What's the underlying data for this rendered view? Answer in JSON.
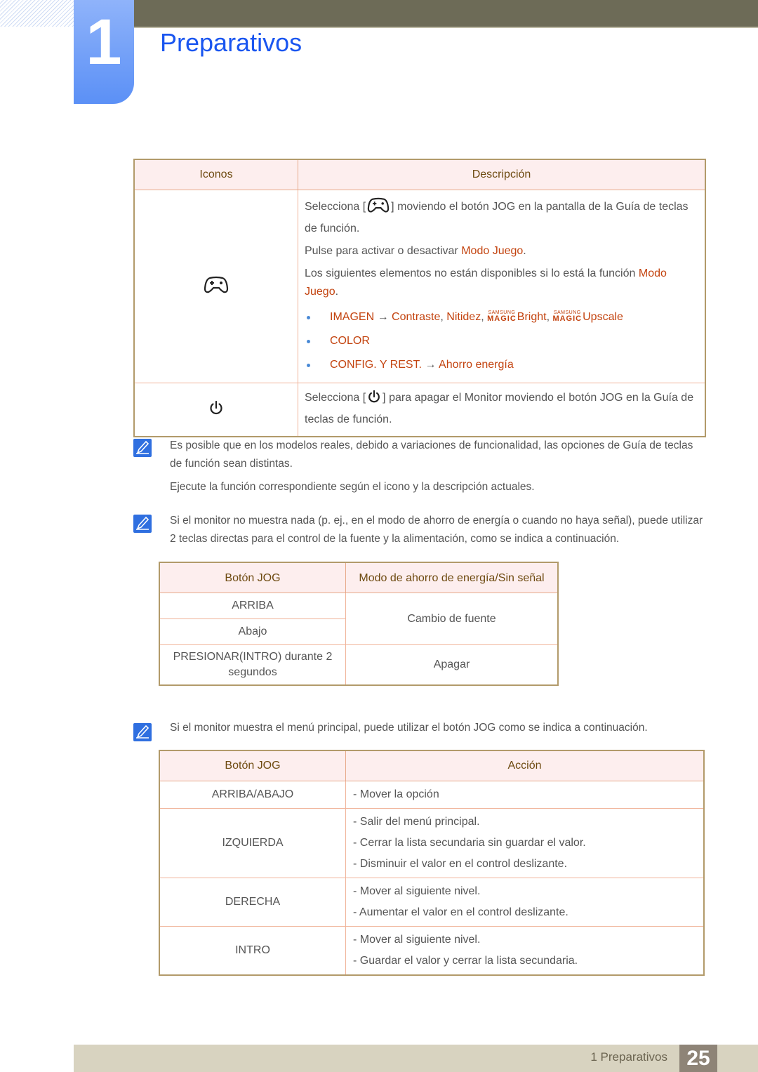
{
  "chapter": {
    "number": "1",
    "title": "Preparativos"
  },
  "icons_table": {
    "headers": [
      "Iconos",
      "Descripción"
    ],
    "rows": [
      {
        "icon": "gamepad-icon",
        "select_prefix": "Selecciona [",
        "select_suffix": "] moviendo el botón JOG en la pantalla de la Guía de teclas de función.",
        "toggle_prefix": "Pulse para activar o desactivar ",
        "toggle_highlight": "Modo Juego",
        "toggle_suffix": ".",
        "unavailable_prefix": "Los siguientes elementos no están disponibles si lo está la función ",
        "unavailable_highlight": "Modo Juego",
        "unavailable_suffix": ".",
        "bullets": [
          {
            "menu": "IMAGEN",
            "arrow": "→",
            "items": [
              "Contraste",
              "Nitidez"
            ],
            "magic_top": "SAMSUNG",
            "magic_bottom": "MAGIC",
            "magic_items": [
              "Bright",
              "Upscale"
            ]
          },
          {
            "menu": "COLOR"
          },
          {
            "menu": "CONFIG. Y REST.",
            "arrow": "→",
            "item": "Ahorro energía"
          }
        ]
      },
      {
        "icon": "power-icon",
        "select_prefix": "Selecciona [",
        "select_suffix": "] para apagar el Monitor moviendo el botón JOG en la Guía de teclas de función."
      }
    ]
  },
  "notes": [
    {
      "icon": "note-pencil-icon",
      "paragraphs": [
        "Es posible que en los modelos reales, debido a variaciones de funcionalidad, las opciones de Guía de teclas de función sean distintas.",
        "Ejecute la función correspondiente según el icono y la descripción actuales."
      ]
    },
    {
      "icon": "note-pencil-icon",
      "paragraphs": [
        "Si el monitor no muestra nada (p. ej., en el modo de ahorro de energía o cuando no haya señal), puede utilizar 2 teclas directas para el control de la fuente y la alimentación, como se indica a continuación."
      ]
    },
    {
      "icon": "note-pencil-icon",
      "paragraphs": [
        "Si el monitor muestra el menú principal, puede utilizar el botón JOG como se indica a continuación."
      ]
    }
  ],
  "power_saving_table": {
    "headers": [
      "Botón JOG",
      "Modo de ahorro de energía/Sin señal"
    ],
    "rows": [
      {
        "button": "ARRIBA",
        "action": "Cambio de fuente"
      },
      {
        "button": "Abajo"
      },
      {
        "button": "PRESIONAR(INTRO) durante 2 segundos",
        "action": "Apagar"
      }
    ]
  },
  "menu_table": {
    "headers": [
      "Botón JOG",
      "Acción"
    ],
    "rows": [
      {
        "button": "ARRIBA/ABAJO",
        "actions": [
          "- Mover la opción"
        ]
      },
      {
        "button": "IZQUIERDA",
        "actions": [
          "- Salir del menú principal.",
          "- Cerrar la lista secundaria sin guardar el valor.",
          "- Disminuir el valor en el control deslizante."
        ]
      },
      {
        "button": "DERECHA",
        "actions": [
          "- Mover al siguiente nivel.",
          "- Aumentar el valor en el control deslizante."
        ]
      },
      {
        "button": "INTRO",
        "actions": [
          "- Mover al siguiente nivel.",
          "- Guardar el valor y cerrar la lista secundaria."
        ]
      }
    ]
  },
  "footer": {
    "section_label": "1 Preparativos",
    "page_number": "25"
  },
  "colors": {
    "accent_blue": "#1a56f0",
    "highlight_red": "#c3430f",
    "header_brown": "#6e4a10",
    "top_bar": "#6d6b57",
    "footer_bar": "#d8d3c0",
    "page_box": "#8e8477"
  }
}
